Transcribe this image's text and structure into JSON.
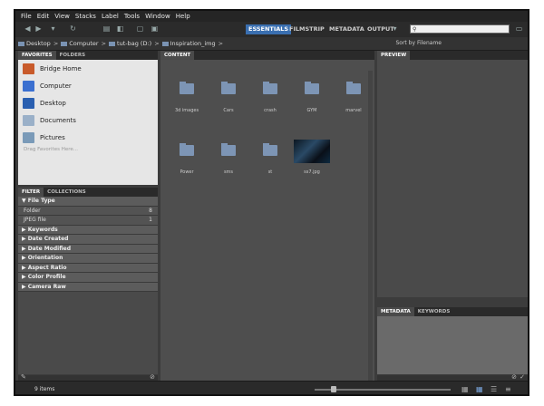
{
  "menu": [
    "File",
    "Edit",
    "View",
    "Stacks",
    "Label",
    "Tools",
    "Window",
    "Help"
  ],
  "workspaces": [
    "ESSENTIALS",
    "FILMSTRIP",
    "METADATA",
    "OUTPUT"
  ],
  "search_placeholder": "",
  "path": [
    "Desktop",
    "Computer",
    "tut-bag (D:)",
    "Inspiration_img"
  ],
  "sort_label": "Sort by Filename",
  "favorites_tabs": [
    "FAVORITES",
    "FOLDERS"
  ],
  "favorites": [
    {
      "label": "Bridge Home",
      "color": "#c85a2a"
    },
    {
      "label": "Computer",
      "color": "#3a6fd0"
    },
    {
      "label": "Desktop",
      "color": "#2a5fb0"
    },
    {
      "label": "Documents",
      "color": "#9ab0c8"
    },
    {
      "label": "Pictures",
      "color": "#7a9ab8"
    }
  ],
  "drag_hint": "Drag Favorites Here...",
  "filter_tabs": [
    "FILTER",
    "COLLECTIONS"
  ],
  "filter": {
    "file_type": "File Type",
    "file_types": [
      {
        "label": "Folder",
        "count": "8"
      },
      {
        "label": "JPEG file",
        "count": "1"
      }
    ],
    "categories": [
      "Keywords",
      "Date Created",
      "Date Modified",
      "Orientation",
      "Aspect Ratio",
      "Color Profile",
      "Camera Raw"
    ]
  },
  "content_tab": "CONTENT",
  "items": [
    {
      "label": "3d images",
      "type": "folder"
    },
    {
      "label": "Cars",
      "type": "folder"
    },
    {
      "label": "crash",
      "type": "folder"
    },
    {
      "label": "GYM",
      "type": "folder"
    },
    {
      "label": "marvel",
      "type": "folder"
    },
    {
      "label": "Power",
      "type": "folder"
    },
    {
      "label": "sms",
      "type": "folder"
    },
    {
      "label": "st",
      "type": "folder"
    },
    {
      "label": "ss7.jpg",
      "type": "image"
    }
  ],
  "preview_tab": "PREVIEW",
  "meta_tabs": [
    "METADATA",
    "KEYWORDS"
  ],
  "status": "9 items"
}
